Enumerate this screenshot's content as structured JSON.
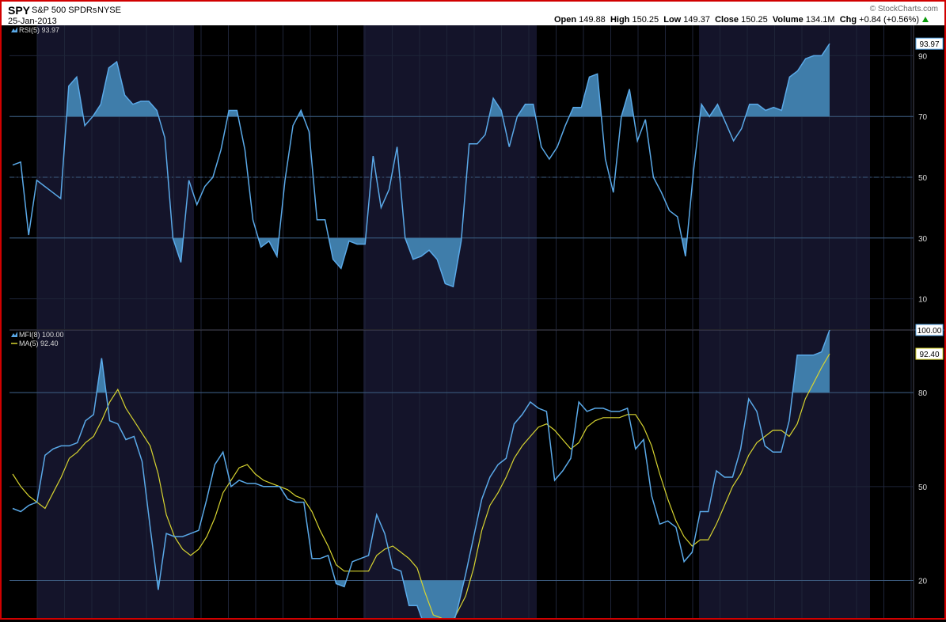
{
  "header": {
    "symbol": "SPY",
    "name": "S&P 500 SPDRs",
    "exchange": "NYSE",
    "date": "25-Jan-2013",
    "copyright": "© StockCharts.com",
    "quote": {
      "open_label": "Open",
      "open": "149.88",
      "high_label": "High",
      "high": "150.25",
      "low_label": "Low",
      "low": "149.37",
      "close_label": "Close",
      "close": "150.25",
      "volume_label": "Volume",
      "volume": "134.1M",
      "chg_label": "Chg",
      "chg": "+0.84 (+0.56%)"
    }
  },
  "colors": {
    "background": "#000000",
    "band": "#14142a",
    "grid": "#1e2438",
    "level_line": "#3d5c80",
    "indicator": "#5aa9e8",
    "fill": "#3f7daa",
    "ma": "#d7d430",
    "axis_text": "#d9d9d9",
    "frame": "#d10000"
  },
  "chart_data": [
    {
      "type": "area",
      "legend": "RSI(5) 93.97",
      "last_value_label": "93.97",
      "series": [
        {
          "values": [
            54,
            55,
            31,
            49,
            47,
            45,
            43,
            80,
            83,
            67,
            70,
            74,
            86,
            88,
            77,
            74,
            75,
            75,
            72,
            63,
            30,
            22,
            49,
            41,
            47,
            50,
            59,
            72,
            72,
            59,
            36,
            27,
            29,
            24,
            49,
            67,
            72,
            65,
            36,
            36,
            23,
            20,
            29,
            28,
            28,
            57,
            40,
            46,
            60,
            30,
            23,
            24,
            26,
            23,
            15,
            14,
            29,
            61,
            61,
            64,
            76,
            72,
            60,
            70,
            74,
            74,
            60,
            56,
            60,
            67,
            73,
            73,
            83,
            84,
            56,
            45,
            70,
            79,
            62,
            69,
            50,
            45,
            39,
            37,
            24,
            52,
            74,
            70,
            74,
            68,
            62,
            66,
            74,
            74,
            72,
            73,
            72,
            83,
            85,
            89,
            90,
            90,
            93.97
          ]
        }
      ],
      "ylim": [
        0,
        100
      ],
      "yticks": [
        10,
        30,
        50,
        70,
        90
      ],
      "overbought": 70,
      "oversold": 30,
      "midline": 50
    },
    {
      "type": "area",
      "legend_mfi": "MFI(8) 100.00",
      "legend_ma": "MA(5) 92.40",
      "last_value_label": "100.00",
      "last_ma_label": "92.40",
      "series": [
        {
          "values": [
            43,
            42,
            44,
            45,
            60,
            62,
            63,
            63,
            64,
            71,
            73,
            91,
            71,
            70,
            65,
            66,
            58,
            37,
            17,
            35,
            34,
            34,
            35,
            36,
            46,
            57,
            61,
            50,
            52,
            51,
            51,
            50,
            50,
            50,
            46,
            45,
            45,
            27,
            27,
            28,
            19,
            18,
            26,
            27,
            28,
            41,
            35,
            24,
            23,
            12,
            12,
            5,
            3,
            3,
            2,
            11,
            22,
            34,
            46,
            53,
            57,
            59,
            70,
            73,
            77,
            75,
            74,
            52,
            55,
            59,
            77,
            74,
            75,
            75,
            74,
            74,
            75,
            62,
            65,
            47,
            38,
            39,
            37,
            26,
            29,
            42,
            42,
            55,
            53,
            53,
            62,
            78,
            74,
            63,
            61,
            61,
            71,
            92,
            92,
            92,
            93,
            100
          ]
        },
        {
          "values": [
            54,
            50,
            47,
            45,
            43,
            48,
            53,
            59,
            61,
            64,
            66,
            71,
            77,
            81,
            75,
            71,
            67,
            63,
            54,
            41,
            34,
            30,
            28,
            30,
            34,
            40,
            48,
            52,
            56,
            57,
            54,
            52,
            51,
            50,
            49,
            47,
            46,
            42,
            36,
            31,
            25,
            23,
            23,
            23,
            23,
            28,
            30,
            31,
            29,
            27,
            24,
            16,
            9,
            8,
            5,
            10,
            15,
            24,
            36,
            44,
            48,
            53,
            59,
            63,
            66,
            69,
            70,
            68,
            65,
            62,
            64,
            69,
            71,
            72,
            72,
            72,
            73,
            73,
            69,
            63,
            54,
            46,
            39,
            34,
            31,
            33,
            33,
            38,
            44,
            50,
            54,
            60,
            64,
            66,
            68,
            68,
            66,
            70,
            78,
            83,
            88,
            92.4
          ]
        }
      ],
      "ylim": [
        8,
        100
      ],
      "yticks": [
        20,
        50,
        80
      ],
      "overbought": 80,
      "oversold": 20
    }
  ]
}
